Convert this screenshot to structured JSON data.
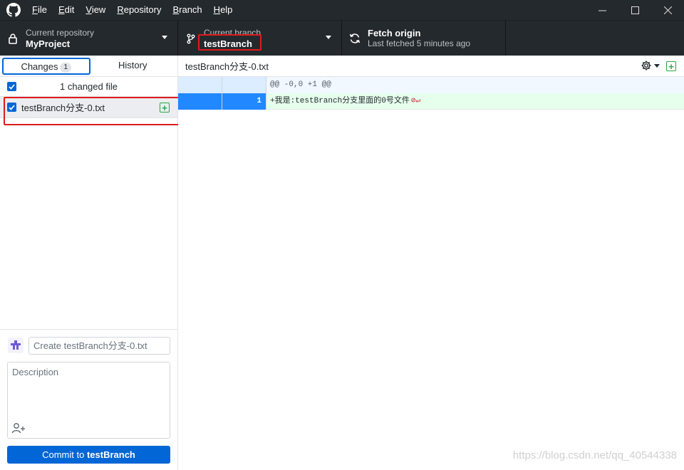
{
  "menu": {
    "items": [
      {
        "key": "F",
        "rest": "ile"
      },
      {
        "key": "E",
        "rest": "dit"
      },
      {
        "key": "V",
        "rest": "iew"
      },
      {
        "key": "R",
        "rest": "epository"
      },
      {
        "key": "B",
        "rest": "ranch"
      },
      {
        "key": "H",
        "rest": "elp"
      }
    ]
  },
  "toolbar": {
    "repo_label": "Current repository",
    "repo_name": "MyProject",
    "branch_label": "Current branch",
    "branch_name": "testBranch",
    "fetch_title": "Fetch origin",
    "fetch_sub": "Last fetched 5 minutes ago"
  },
  "tabs": {
    "changes": "Changes",
    "changes_count": "1",
    "history": "History"
  },
  "changes": {
    "header": "1 changed file",
    "file": "testBranch分支-0.txt"
  },
  "commit": {
    "summary_placeholder": "Create testBranch分支-0.txt",
    "description_placeholder": "Description",
    "button_prefix": "Commit to ",
    "button_branch": "testBranch"
  },
  "diff": {
    "path": "testBranch分支-0.txt",
    "hunk": "@@ -0,0 +1 @@",
    "line_number": "1",
    "line_text": "+我是:testBranch分支里面的0号文件"
  },
  "watermark": "https://blog.csdn.net/qq_40544338",
  "colors": {
    "accent": "#0366d6",
    "added": "#28a745",
    "highlight": "#e01b1b"
  }
}
